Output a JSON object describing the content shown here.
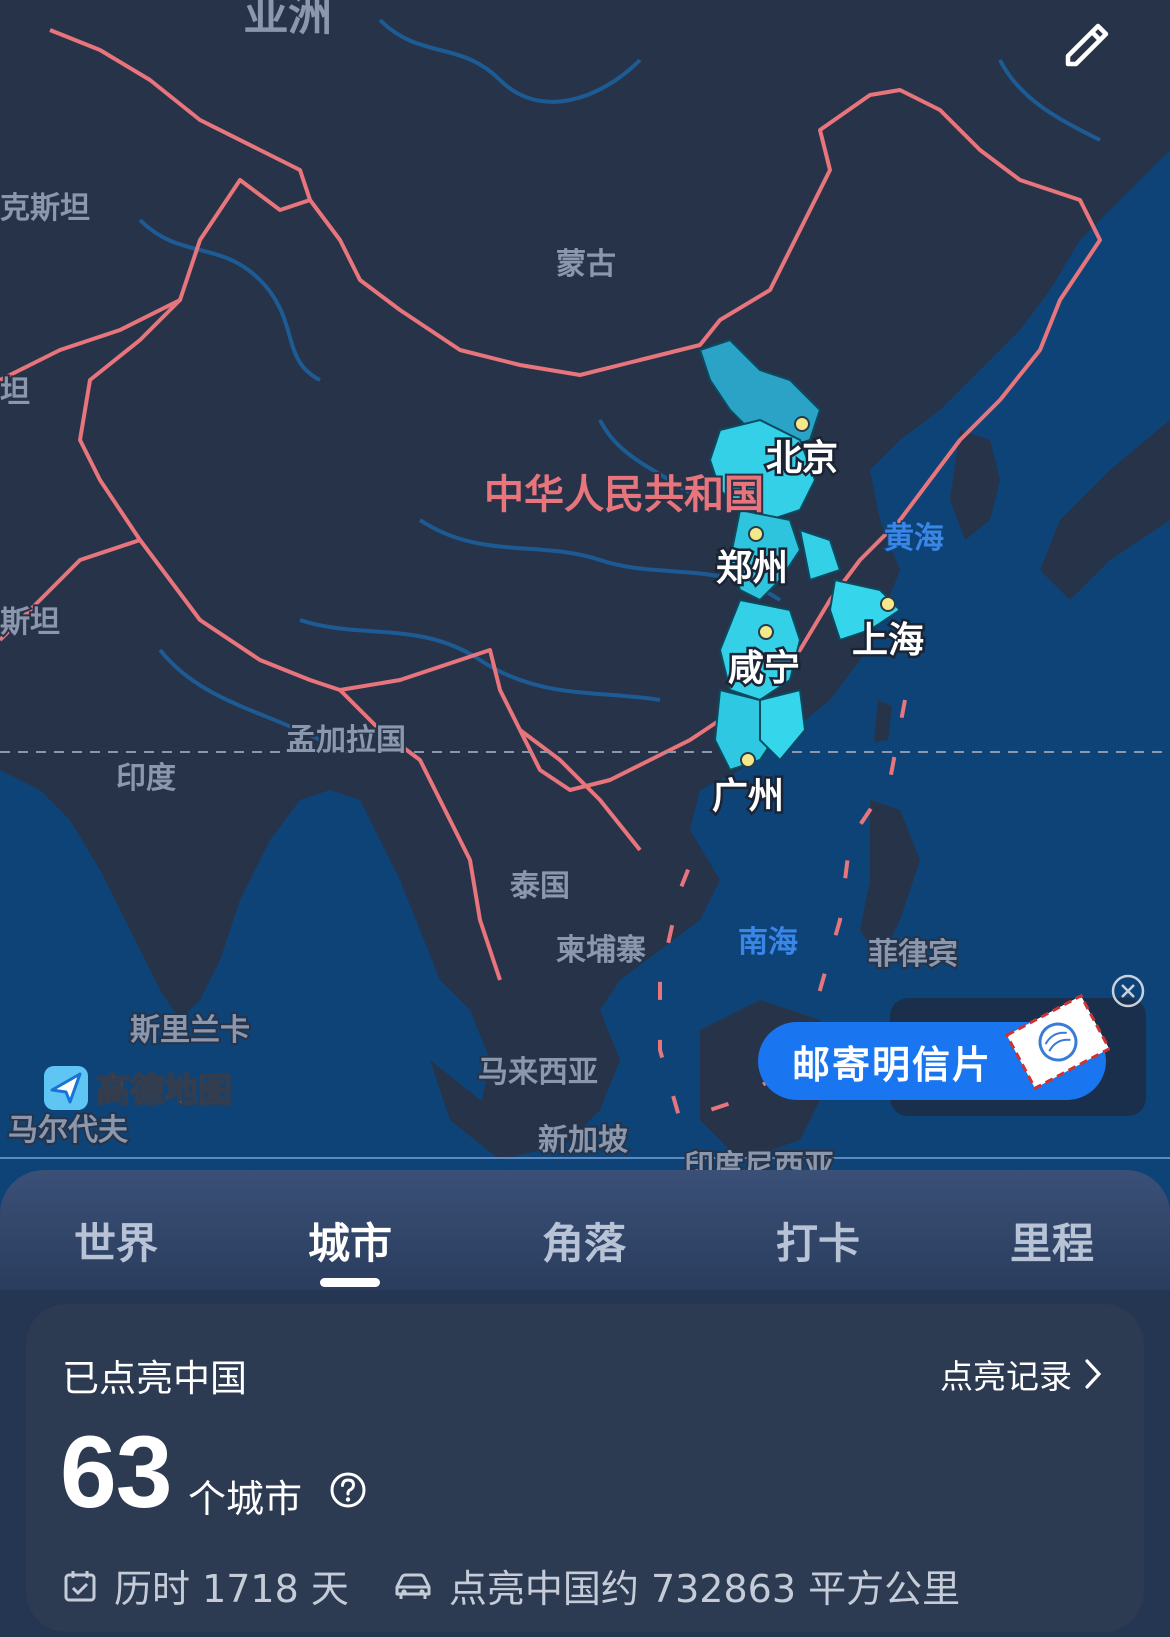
{
  "map": {
    "country_labels": {
      "asia": "亚洲",
      "kazakhstan": "克斯坦",
      "mongolia": "蒙古",
      "tajikistan": "坦",
      "pakistan": "斯坦",
      "china": "中华人民共和国",
      "bangladesh": "孟加拉国",
      "india": "印度",
      "thailand": "泰国",
      "cambodia": "柬埔寨",
      "philippines": "菲律宾",
      "sri_lanka": "斯里兰卡",
      "malaysia": "马来西亚",
      "maldives": "马尔代夫",
      "singapore": "新加坡",
      "indonesia": "印度尼西亚"
    },
    "sea_labels": {
      "yellow_sea": "黄海",
      "south_china_sea": "南海"
    },
    "cities": [
      "北京",
      "郑州",
      "上海",
      "咸宁",
      "广州"
    ],
    "brand": "高德地图",
    "postcard_label": "邮寄明信片",
    "colors": {
      "land": "#263349",
      "sea": "#0e4377",
      "border": "#e8747c",
      "highlight": "#33d0e8",
      "city_dot": "#f4e98a"
    }
  },
  "tabs": [
    {
      "label": "世界",
      "active": false
    },
    {
      "label": "城市",
      "active": true
    },
    {
      "label": "角落",
      "active": false
    },
    {
      "label": "打卡",
      "active": false
    },
    {
      "label": "里程",
      "active": false
    }
  ],
  "summary": {
    "title": "已点亮中国",
    "record_link": "点亮记录",
    "count": "63",
    "unit": "个城市",
    "days": "历时 1718 天",
    "area": "点亮中国约 732863 平方公里"
  },
  "icons": {
    "edit": "pencil-icon",
    "close": "close-circle-icon",
    "help": "question-circle-icon",
    "calendar": "calendar-check-icon",
    "car": "car-icon",
    "chevron": "chevron-right-icon",
    "brand_logo": "navigation-arrow-icon"
  }
}
